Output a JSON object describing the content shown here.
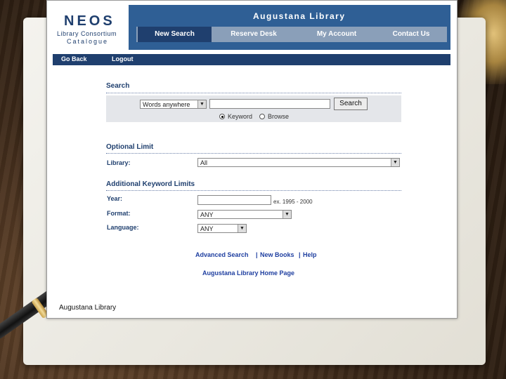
{
  "header": {
    "logo_brand": "NEOS",
    "logo_line1": "Library Consortium",
    "logo_line2": "Catalogue",
    "library_title": "Augustana Library"
  },
  "nav_tabs": [
    {
      "label": "New Search",
      "active": true
    },
    {
      "label": "Reserve Desk",
      "active": false
    },
    {
      "label": "My Account",
      "active": false
    },
    {
      "label": "Contact Us",
      "active": false
    }
  ],
  "subnav": {
    "go_back": "Go Back",
    "logout": "Logout"
  },
  "search": {
    "section_title": "Search",
    "scope_selected": "Words anywhere",
    "query_value": "",
    "search_button": "Search",
    "mode_options": [
      {
        "label": "Keyword",
        "checked": true
      },
      {
        "label": "Browse",
        "checked": false
      }
    ]
  },
  "optional_limit": {
    "section_title": "Optional Limit",
    "library_label": "Library:",
    "library_selected": "All"
  },
  "additional_limits": {
    "section_title": "Additional Keyword Limits",
    "year_label": "Year:",
    "year_value": "",
    "year_hint": "ex. 1995 - 2000",
    "format_label": "Format:",
    "format_selected": "ANY",
    "language_label": "Language:",
    "language_selected": "ANY"
  },
  "links": {
    "advanced_search": "Advanced Search",
    "new_books": "New Books",
    "help": "Help",
    "separator": "|",
    "home_page": "Augustana Library Home Page"
  },
  "footer": {
    "label": "Augustana Library"
  },
  "colors": {
    "header_blue": "#2f5f95",
    "dark_blue": "#1f3f6e",
    "tab_gray": "#8a9fb9",
    "link_blue": "#1f3fa0"
  }
}
